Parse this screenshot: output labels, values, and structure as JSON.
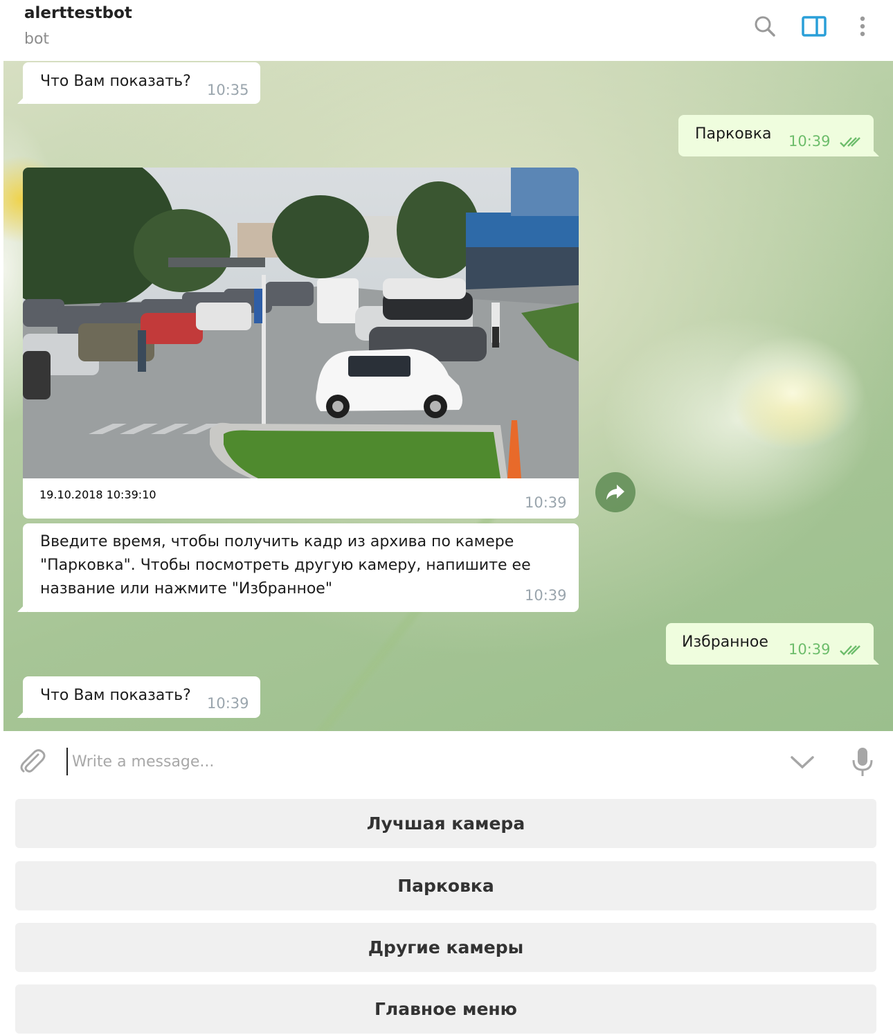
{
  "header": {
    "title": "alerttestbot",
    "status": "bot",
    "icons": [
      "search-icon",
      "side-panel-icon",
      "more-vert-icon"
    ],
    "accent_color": "#2a9fd8"
  },
  "messages": [
    {
      "direction": "in",
      "text": "Что Вам показать?",
      "time": "10:35"
    },
    {
      "direction": "out",
      "text": "Парковка",
      "time": "10:39",
      "read": true
    },
    {
      "direction": "in",
      "type": "photo",
      "caption": "19.10.2018 10:39:10",
      "time": "10:39"
    },
    {
      "direction": "in",
      "lines": [
        "Введите время, чтобы получить кадр из архива по камере",
        "\"Парковка\". Чтобы посмотреть другую камеру, напишите ее",
        "название или нажмите \"Избранное\""
      ],
      "time": "10:39"
    },
    {
      "direction": "out",
      "text": "Избранное",
      "time": "10:39",
      "read": true
    },
    {
      "direction": "in",
      "text": "Что Вам показать?",
      "time": "10:39"
    }
  ],
  "composer": {
    "placeholder": "Write a message...",
    "icons": [
      "attach-icon",
      "chevron-down-icon",
      "mic-icon"
    ]
  },
  "keyboard": {
    "buttons": [
      "Лучшая камера",
      "Парковка",
      "Другие камеры",
      "Главное меню"
    ]
  },
  "colors": {
    "outgoing_bubble": "#effdde",
    "incoming_bubble": "#ffffff",
    "read_check": "#6dbd6b",
    "keyboard_button": "#f0f0f0"
  }
}
